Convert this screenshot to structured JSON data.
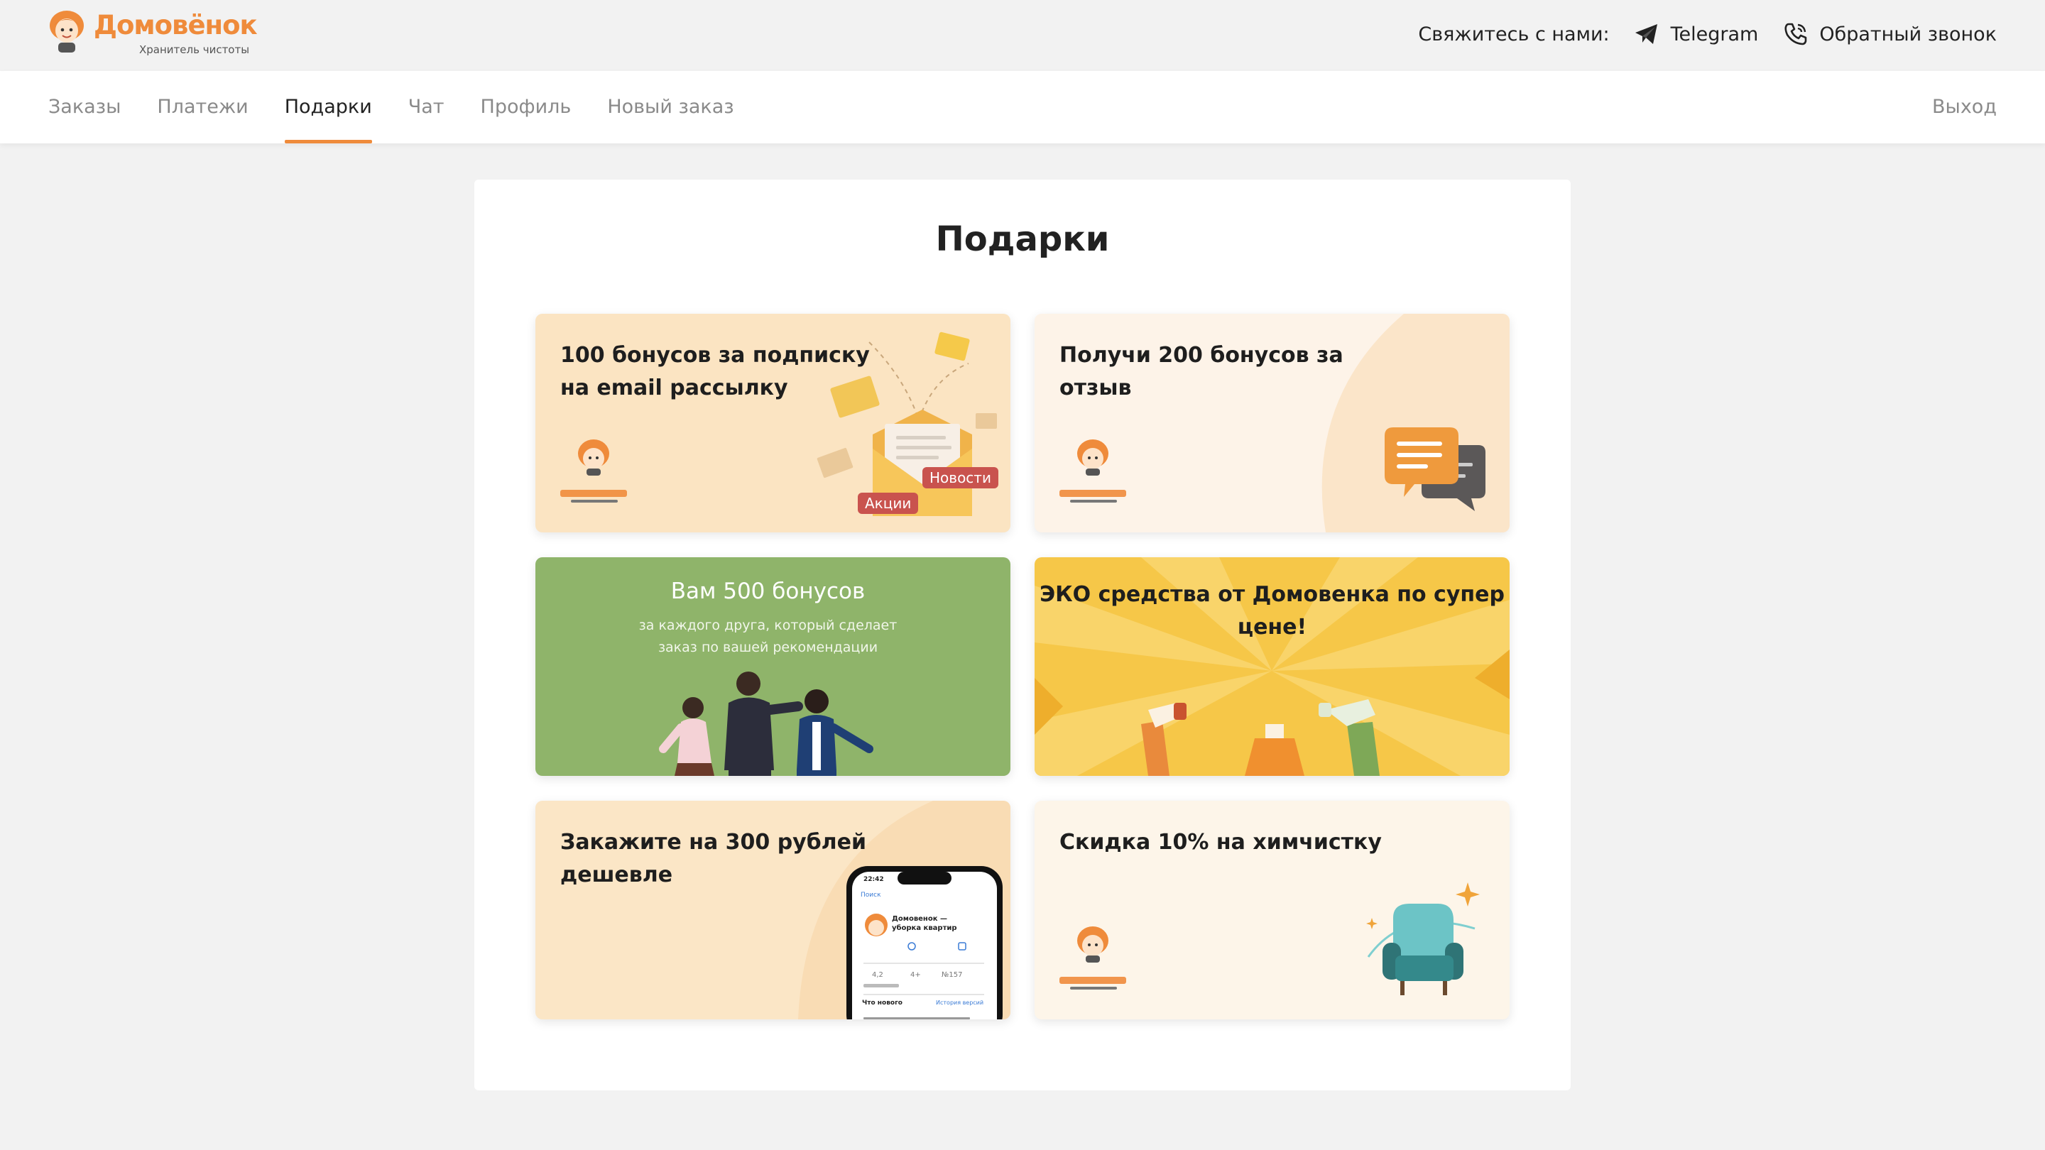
{
  "brand": {
    "name": "Домовёнок",
    "tagline": "Хранитель чистоты",
    "accent": "#ef8b3b"
  },
  "contact": {
    "label": "Свяжитесь с нами:",
    "telegram": "Telegram",
    "callback": "Обратный звонок",
    "telegram_icon": "paper-plane-icon",
    "callback_icon": "phone-icon"
  },
  "nav": {
    "tabs": [
      {
        "label": "Заказы",
        "active": false
      },
      {
        "label": "Платежи",
        "active": false
      },
      {
        "label": "Подарки",
        "active": true
      },
      {
        "label": "Чат",
        "active": false
      },
      {
        "label": "Профиль",
        "active": false
      },
      {
        "label": "Новый заказ",
        "active": false
      }
    ],
    "logout": "Выход"
  },
  "page": {
    "title": "Подарки"
  },
  "gifts": [
    {
      "title": "100 бонусов за подписку на email рассылку",
      "badges": [
        "Новости",
        "Акции"
      ],
      "bg": "#fbe4c2"
    },
    {
      "title": "Получи 200 бонусов за отзыв",
      "bg": "#fdf3e8"
    },
    {
      "title": "Вам 500 бонусов",
      "subtitle": "за каждого друга, который сделает заказ по вашей рекомендации",
      "bg": "#8fb46a"
    },
    {
      "title": "ЭКО средства от Домовенка по супер цене!",
      "bg": "#f6c748"
    },
    {
      "title": "Закажите на 300 рублей дешевле",
      "bg": "#fbe6c6"
    },
    {
      "title": "Скидка 10% на химчистку",
      "bg": "#fdf5e9"
    }
  ],
  "phone_mock": {
    "time": "22:42",
    "back": "Поиск",
    "app_title": "Домовенок — уборка квартир",
    "rating": "4,2",
    "age": "4+",
    "rank": "№157",
    "whats_new": "Что нового",
    "history": "История версий"
  }
}
